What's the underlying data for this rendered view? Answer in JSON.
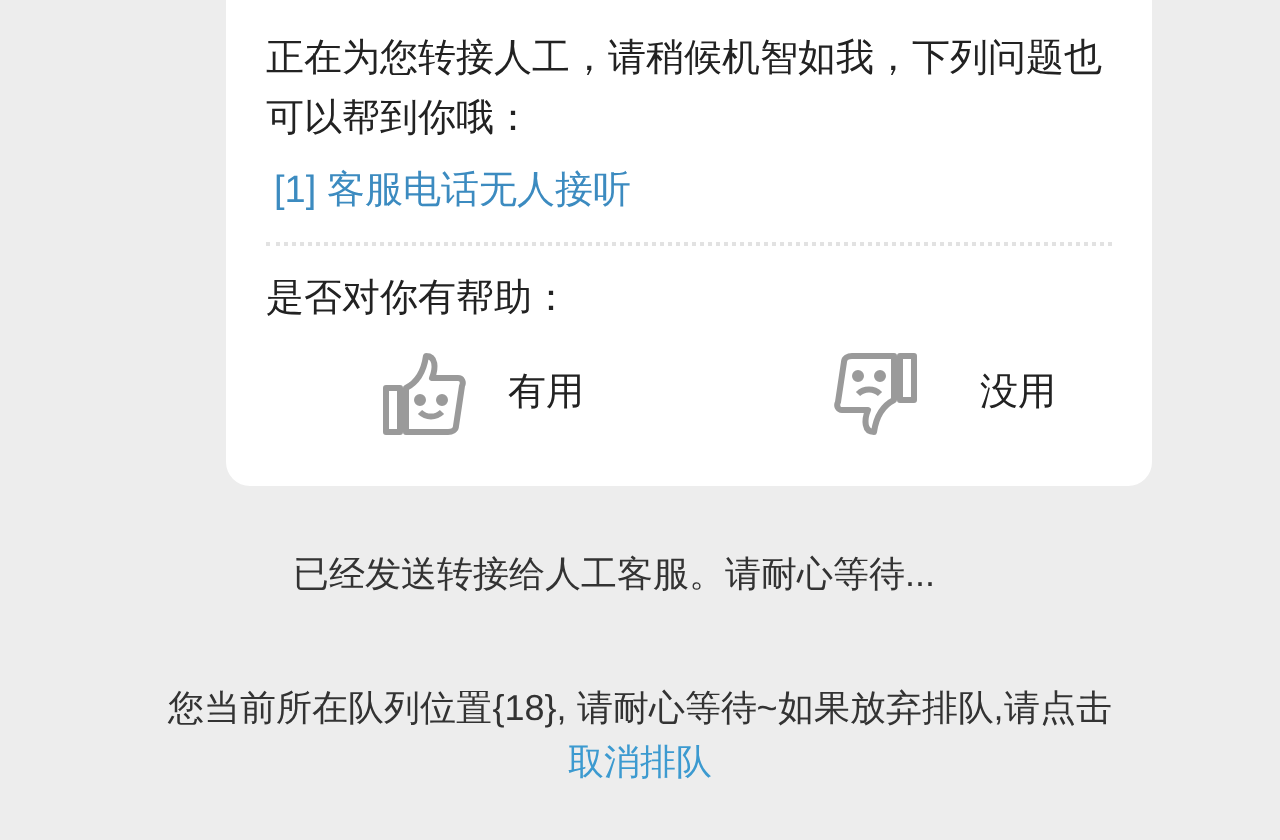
{
  "bot_message": {
    "text": "正在为您转接人工，请稍候机智如我，下列问题也可以帮到你哦：",
    "suggestions": [
      "[1] 客服电话无人接听"
    ],
    "feedback_prompt": "是否对你有帮助：",
    "feedback": [
      {
        "kind": "up",
        "label": "有用"
      },
      {
        "kind": "down",
        "label": "没用"
      }
    ]
  },
  "system_messages": [
    {
      "text": "已经发送转接给人工客服。请耐心等待..."
    },
    {
      "text": "您当前所在队列位置{18}, 请耐心等待~如果放弃排队,请点击",
      "link": "取消排队"
    }
  ]
}
